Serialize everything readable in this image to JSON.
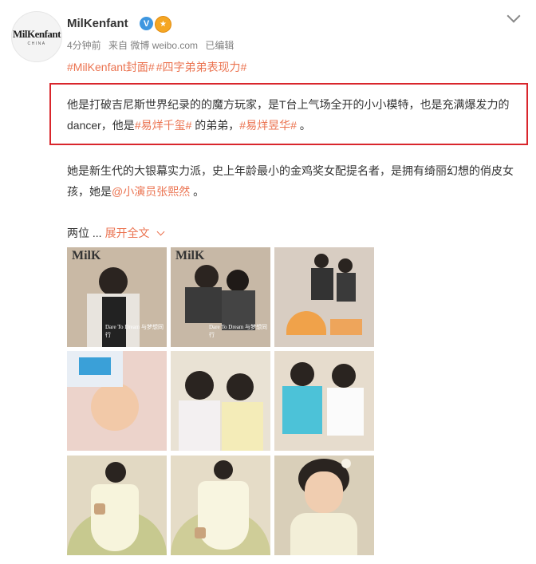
{
  "post": {
    "username": "MilKenfant",
    "avatar_logo": "MilKenfant",
    "avatar_sub": "CHINA",
    "verified": "V",
    "meta": {
      "time": "4分钟前",
      "from": "来自 微博 weibo.com",
      "edited": "已编辑"
    },
    "tags": [
      "#MilKenfant封面#",
      "#四字弟弟表现力#"
    ],
    "para1": {
      "text1": "他是打破吉尼斯世界纪录的的魔方玩家，是T台上气场全开的小小模特，也是充满爆发力的dancer，他是",
      "link1": "#易烊千玺#",
      "text2": " 的弟弟，",
      "link2": "#易烊昱华#",
      "text3": " 。"
    },
    "para2": {
      "text1": "她是新生代的大银幕实力派，史上年龄最小的金鸡奖女配提名者，是拥有绮丽幻想的俏皮女孩，她是",
      "link1": "@小演员张熙然",
      "text2": " 。"
    },
    "more": {
      "prefix": "两位 ...",
      "expand": "展开全文"
    },
    "photos": [
      {
        "name": "photo-1",
        "mag": "MilK",
        "caption": "Dare To Dream 与梦想同行",
        "bg": "#c9b9a5"
      },
      {
        "name": "photo-2",
        "mag": "MilK",
        "caption": "Dare To Dream 与梦想同行",
        "bg": "#c7b8a6"
      },
      {
        "name": "photo-3",
        "mag": "",
        "caption": "",
        "bg": "#d8cdc2"
      },
      {
        "name": "photo-4",
        "mag": "",
        "caption": "",
        "bg": "#ecd3cb"
      },
      {
        "name": "photo-5",
        "mag": "",
        "caption": "",
        "bg": "#e9e2d4"
      },
      {
        "name": "photo-6",
        "mag": "",
        "caption": "",
        "bg": "#e6dccd"
      },
      {
        "name": "photo-7",
        "mag": "",
        "caption": "",
        "bg": "#e2d9c3"
      },
      {
        "name": "photo-8",
        "mag": "",
        "caption": "",
        "bg": "#e5dcc7"
      },
      {
        "name": "photo-9",
        "mag": "",
        "caption": "",
        "bg": "#d9cfb9"
      }
    ]
  }
}
